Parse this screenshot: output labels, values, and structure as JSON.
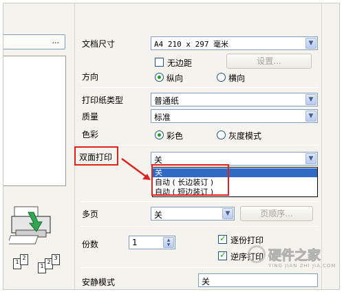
{
  "left_button": {
    "label": "..."
  },
  "fields": {
    "doc_size": {
      "label": "文档尺寸",
      "value": "A4 210 x 297 毫米"
    },
    "borderless": {
      "label": "无边距",
      "checked": false
    },
    "settings_button": {
      "label": "设置..."
    },
    "orientation": {
      "label": "方向",
      "options": [
        "纵向",
        "横向"
      ],
      "selected": "纵向"
    },
    "paper_type": {
      "label": "打印纸类型",
      "value": "普通纸"
    },
    "quality": {
      "label": "质量",
      "value": "标准"
    },
    "color": {
      "label": "色彩",
      "options": [
        "彩色",
        "灰度模式"
      ],
      "selected": "彩色"
    },
    "duplex": {
      "label": "双面打印",
      "value": "关",
      "dropdown_open": true,
      "options": [
        "关",
        "自动 ( 长边装订 )",
        "自动 ( 短边装订 )"
      ],
      "highlighted": "关"
    },
    "multipage": {
      "label": "多页",
      "value": "关"
    },
    "page_order_button": {
      "label": "页顺序..."
    },
    "copies": {
      "label": "份数",
      "value": "1"
    },
    "collate": {
      "label": "逐份打印",
      "checked": true
    },
    "reverse": {
      "label": "逆序打印",
      "checked": true
    },
    "quiet_mode": {
      "label": "安静模式",
      "value": "关"
    }
  },
  "thumbnails": [
    "1",
    "2",
    "1",
    "2",
    "3"
  ],
  "watermark": {
    "brand": "硬件之家",
    "url": "YING JIAN ZHI JIA.COM"
  },
  "colors": {
    "annotation_red": "#e0201c",
    "selection_blue": "#316ac5",
    "check_green": "#21a121"
  }
}
